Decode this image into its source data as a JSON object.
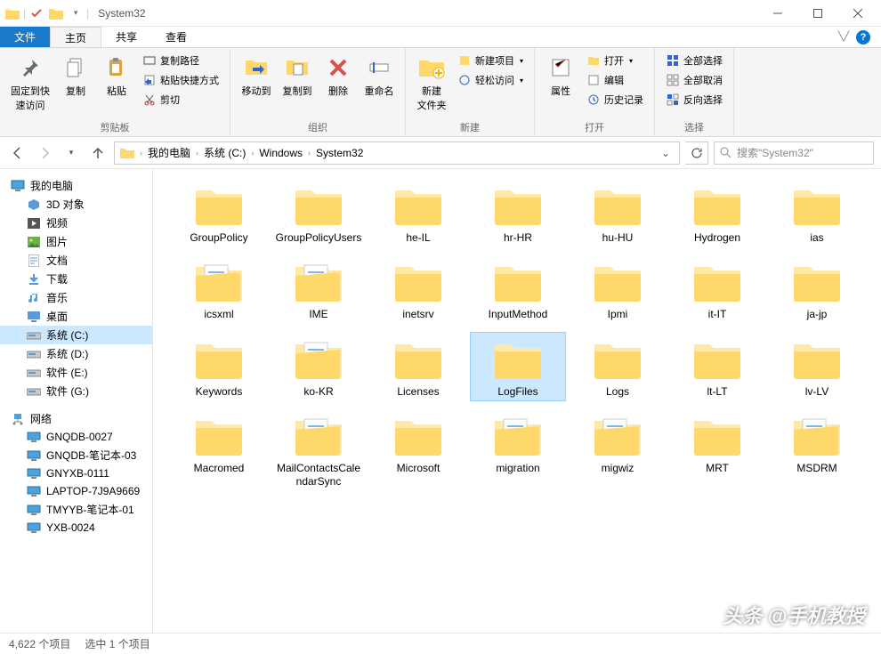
{
  "window": {
    "title": "System32"
  },
  "tabs": {
    "file": "文件",
    "home": "主页",
    "share": "共享",
    "view": "查看"
  },
  "ribbon": {
    "clipboard": {
      "label": "剪贴板",
      "pin": "固定到快\n速访问",
      "copy": "复制",
      "paste": "粘贴",
      "copy_path": "复制路径",
      "paste_shortcut": "粘贴快捷方式",
      "cut": "剪切"
    },
    "organize": {
      "label": "组织",
      "move": "移动到",
      "copyto": "复制到",
      "delete": "删除",
      "rename": "重命名"
    },
    "new": {
      "label": "新建",
      "folder": "新建\n文件夹",
      "item": "新建项目",
      "easy": "轻松访问"
    },
    "open": {
      "label": "打开",
      "props": "属性",
      "open": "打开",
      "edit": "编辑",
      "history": "历史记录"
    },
    "select": {
      "label": "选择",
      "all": "全部选择",
      "none": "全部取消",
      "invert": "反向选择"
    }
  },
  "breadcrumb": [
    "我的电脑",
    "系统 (C:)",
    "Windows",
    "System32"
  ],
  "search_placeholder": "搜索\"System32\"",
  "sidebar": {
    "mypc": "我的电脑",
    "items1": [
      "3D 对象",
      "视频",
      "图片",
      "文档",
      "下载",
      "音乐",
      "桌面"
    ],
    "drives": [
      "系统 (C:)",
      "系统 (D:)",
      "软件 (E:)",
      "软件 (G:)"
    ],
    "network": "网络",
    "net_items": [
      "GNQDB-0027",
      "GNQDB-笔记本-03",
      "GNYXB-0111",
      "LAPTOP-7J9A9669",
      "TMYYB-笔记本-01",
      "YXB-0024"
    ]
  },
  "folders": [
    {
      "name": "GroupPolicy",
      "type": "folder"
    },
    {
      "name": "GroupPolicyUsers",
      "type": "folder"
    },
    {
      "name": "he-IL",
      "type": "folder"
    },
    {
      "name": "hr-HR",
      "type": "folder"
    },
    {
      "name": "hu-HU",
      "type": "folder"
    },
    {
      "name": "Hydrogen",
      "type": "folder"
    },
    {
      "name": "ias",
      "type": "folder"
    },
    {
      "name": "icsxml",
      "type": "folder-doc"
    },
    {
      "name": "IME",
      "type": "folder-doc"
    },
    {
      "name": "inetsrv",
      "type": "folder"
    },
    {
      "name": "InputMethod",
      "type": "folder"
    },
    {
      "name": "Ipmi",
      "type": "folder"
    },
    {
      "name": "it-IT",
      "type": "folder"
    },
    {
      "name": "ja-jp",
      "type": "folder"
    },
    {
      "name": "Keywords",
      "type": "folder"
    },
    {
      "name": "ko-KR",
      "type": "folder-doc"
    },
    {
      "name": "Licenses",
      "type": "folder"
    },
    {
      "name": "LogFiles",
      "type": "folder",
      "selected": true
    },
    {
      "name": "Logs",
      "type": "folder"
    },
    {
      "name": "lt-LT",
      "type": "folder"
    },
    {
      "name": "lv-LV",
      "type": "folder"
    },
    {
      "name": "Macromed",
      "type": "folder"
    },
    {
      "name": "MailContactsCalendarSync",
      "type": "folder-doc"
    },
    {
      "name": "Microsoft",
      "type": "folder"
    },
    {
      "name": "migration",
      "type": "folder-doc"
    },
    {
      "name": "migwiz",
      "type": "folder-doc"
    },
    {
      "name": "MRT",
      "type": "folder"
    },
    {
      "name": "MSDRM",
      "type": "folder-doc"
    }
  ],
  "status": {
    "count": "4,622 个项目",
    "selected": "选中 1 个项目"
  },
  "watermark": "头条 @手机教授"
}
